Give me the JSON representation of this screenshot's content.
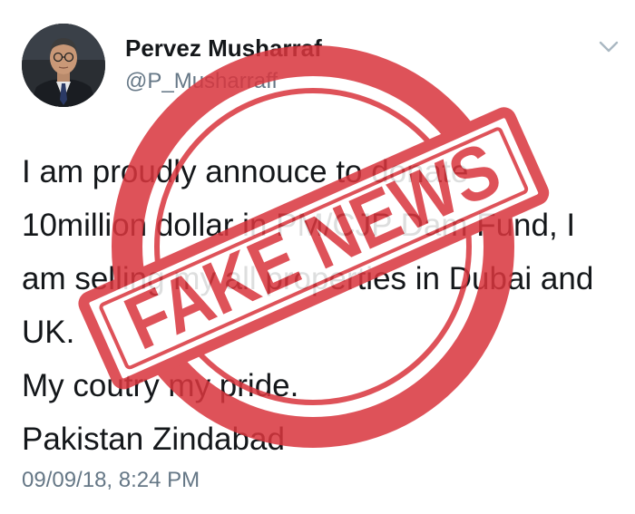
{
  "tweet": {
    "display_name": "Pervez Musharraf",
    "handle": "@P_Musharraff",
    "text_lines": [
      "I am proudly annouce to donate",
      "10million dollar in PM/CJP Dam Fund, I",
      "am selling my all properties in Dubai and",
      "UK.",
      "My coutry my pride.",
      "Pakistan Zindabad"
    ],
    "timestamp": "09/09/18, 8:24 PM",
    "avatar_icon": "profile-photo",
    "menu_icon": "chevron-down-icon"
  },
  "stamp": {
    "text": "FAKE NEWS",
    "color": "#d9363e"
  },
  "colors": {
    "text": "#14171a",
    "secondary": "#657786",
    "background": "#ffffff"
  }
}
